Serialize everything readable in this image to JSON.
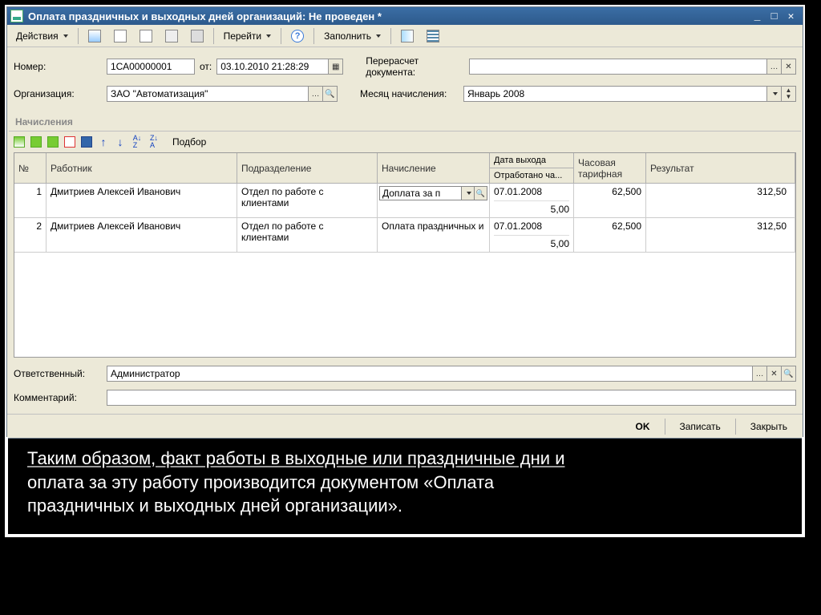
{
  "window": {
    "title": "Оплата праздничных и выходных дней организаций: Не проведен *"
  },
  "toolbar": {
    "actions_label": "Действия",
    "goto_label": "Перейти",
    "fill_label": "Заполнить"
  },
  "form": {
    "number_label": "Номер:",
    "number_value": "1СА00000001",
    "from_label": "от:",
    "date_value": "03.10.2010 21:28:29",
    "recalc_label": "Перерасчет документа:",
    "recalc_value": "",
    "org_label": "Организация:",
    "org_value": "ЗАО \"Автоматизация\"",
    "month_label": "Месяц начисления:",
    "month_value": "Январь 2008"
  },
  "section": {
    "title": "Начисления",
    "select_label": "Подбор"
  },
  "grid": {
    "headers": {
      "num": "№",
      "employee": "Работник",
      "department": "Подразделение",
      "accrual": "Начисление",
      "date_out": "Дата выхода",
      "worked_hours": "Отработано ча...",
      "hour_rate": "Часовая тарифная",
      "result": "Результат"
    },
    "rows": [
      {
        "num": "1",
        "employee": "Дмитриев Алексей Иванович",
        "department": "Отдел по работе с клиентами",
        "accrual": "Доплата за п",
        "date_out": "07.01.2008",
        "worked_hours": "5,00",
        "hour_rate": "62,500",
        "result": "312,50"
      },
      {
        "num": "2",
        "employee": "Дмитриев Алексей Иванович",
        "department": "Отдел по работе с клиентами",
        "accrual": "Оплата праздничных и",
        "date_out": "07.01.2008",
        "worked_hours": "5,00",
        "hour_rate": "62,500",
        "result": "312,50"
      }
    ]
  },
  "bottom": {
    "responsible_label": "Ответственный:",
    "responsible_value": "Администратор",
    "comment_label": "Комментарий:",
    "comment_value": ""
  },
  "footer": {
    "ok": "OK",
    "save": "Записать",
    "close": "Закрыть"
  },
  "caption": {
    "line1": "Таким образом, факт работы в выходные или праздничные дни и",
    "line2": "оплата за эту работу производится документом «Оплата",
    "line3": "праздничных и выходных дней организации»."
  }
}
